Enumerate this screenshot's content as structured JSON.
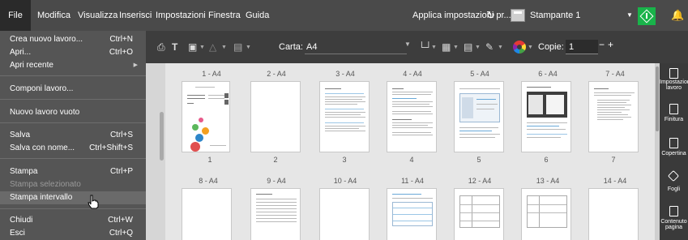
{
  "menubar": {
    "items": [
      "File",
      "Modifica",
      "Visualizza",
      "Inserisci",
      "Impostazioni",
      "Finestra",
      "Guida"
    ],
    "apply_settings": "Applica impostazioni pr...",
    "printer_name": "Stampante 1"
  },
  "toolbar": {
    "paper_label": "Carta:",
    "paper_value": "A4",
    "copies_label": "Copie:",
    "copies_value": "1",
    "minus": "−",
    "plus": "+"
  },
  "file_menu": {
    "items": [
      {
        "label": "Crea nuovo lavoro...",
        "shortcut": "Ctrl+N"
      },
      {
        "label": "Apri...",
        "shortcut": "Ctrl+O"
      },
      {
        "label": "Apri recente",
        "shortcut": ""
      },
      {
        "label": "Componi lavoro...",
        "shortcut": ""
      },
      {
        "label": "Nuovo lavoro vuoto",
        "shortcut": ""
      },
      {
        "label": "Salva",
        "shortcut": "Ctrl+S"
      },
      {
        "label": "Salva con nome...",
        "shortcut": "Ctrl+Shift+S"
      },
      {
        "label": "Stampa",
        "shortcut": "Ctrl+P"
      },
      {
        "label": "Stampa selezionato",
        "shortcut": ""
      },
      {
        "label": "Stampa intervallo",
        "shortcut": ""
      },
      {
        "label": "Chiudi",
        "shortcut": "Ctrl+W"
      },
      {
        "label": "Esci",
        "shortcut": "Ctrl+Q"
      }
    ]
  },
  "pages": {
    "row1_labels": [
      "1 - A4",
      "2 - A4",
      "3 - A4",
      "4 - A4",
      "5 - A4",
      "6 - A4",
      "7 - A4"
    ],
    "row1_numbers": [
      "1",
      "2",
      "3",
      "4",
      "5",
      "6",
      "7"
    ],
    "row2_labels": [
      "8 - A4",
      "9 - A4",
      "10 - A4",
      "11 - A4",
      "12 - A4",
      "13 - A4",
      "14 - A4"
    ]
  },
  "right_panel": {
    "items": [
      "Impostazioni lavoro",
      "Finitura",
      "Copertina",
      "Fogli",
      "Contenuto pagina"
    ]
  },
  "colors": {
    "menubar_bg": "#4a4a4a",
    "toolbar_bg": "#3d3d3d",
    "menu_bg": "#555555",
    "accent_green": "#19b34a",
    "selection_blue": "#2e86c9"
  }
}
